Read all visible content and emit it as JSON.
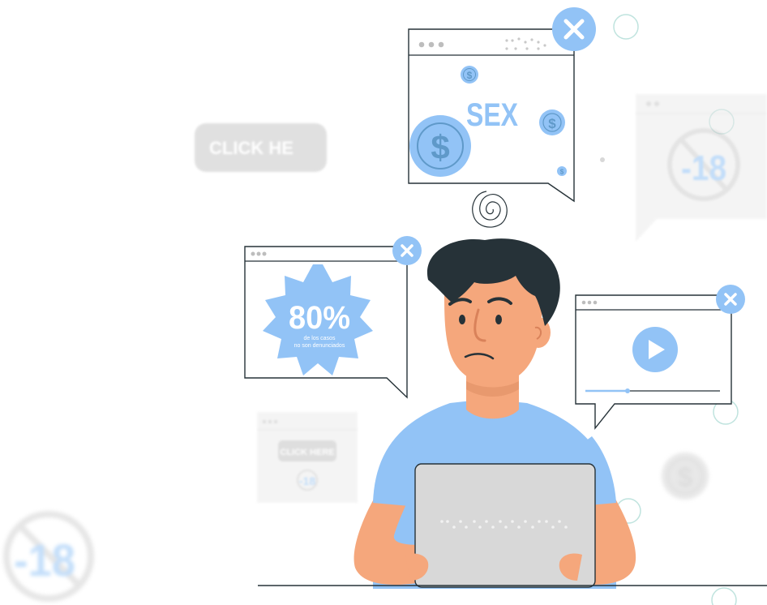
{
  "ads": {
    "click_button_text": "CLICK HE",
    "sex_popup_text": "SEX",
    "dollar_symbol": "$",
    "discount_percent": "80%",
    "discount_caption_line1": "de los casos",
    "discount_caption_line2": "no son denunciados",
    "small_click_here": "CLICK HERE",
    "age_restriction": "-18",
    "close_symbol": "×"
  },
  "colors": {
    "accent": "#92c3f6",
    "accent_dark": "#5f99c9",
    "skin": "#f5a77c",
    "hair": "#263238",
    "shirt": "#92c3f6",
    "laptop": "#d8d8d8"
  }
}
